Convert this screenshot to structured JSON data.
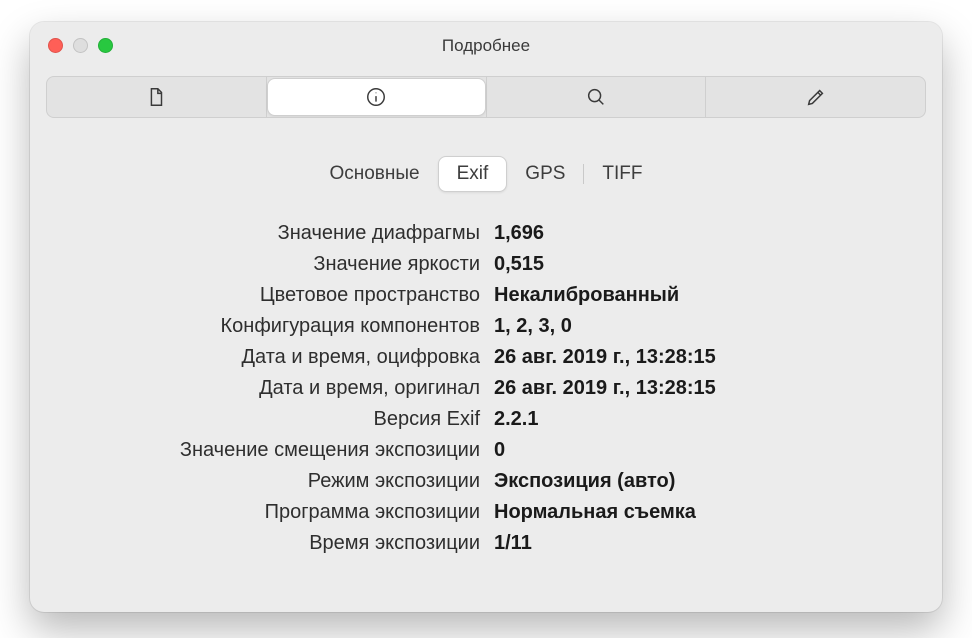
{
  "window": {
    "title": "Подробнее"
  },
  "toolbar": {
    "segs": [
      "file",
      "info",
      "search",
      "edit"
    ],
    "active": "info"
  },
  "subtabs": {
    "items": [
      {
        "label": "Основные"
      },
      {
        "label": "Exif"
      },
      {
        "label": "GPS"
      },
      {
        "label": "TIFF"
      }
    ],
    "active": 1
  },
  "exif": {
    "rows": [
      {
        "label": "Значение диафрагмы",
        "value": "1,696"
      },
      {
        "label": "Значение яркости",
        "value": "0,515"
      },
      {
        "label": "Цветовое пространство",
        "value": "Некалиброванный"
      },
      {
        "label": "Конфигурация компонентов",
        "value": "1, 2, 3, 0"
      },
      {
        "label": "Дата и время, оцифровка",
        "value": "26 авг. 2019 г., 13:28:15"
      },
      {
        "label": "Дата и время, оригинал",
        "value": "26 авг. 2019 г., 13:28:15"
      },
      {
        "label": "Версия Exif",
        "value": "2.2.1"
      },
      {
        "label": "Значение смещения экспозиции",
        "value": "0"
      },
      {
        "label": "Режим экспозиции",
        "value": "Экспозиция (авто)"
      },
      {
        "label": "Программа экспозиции",
        "value": "Нормальная съемка"
      },
      {
        "label": "Время экспозиции",
        "value": "1/11"
      }
    ]
  }
}
